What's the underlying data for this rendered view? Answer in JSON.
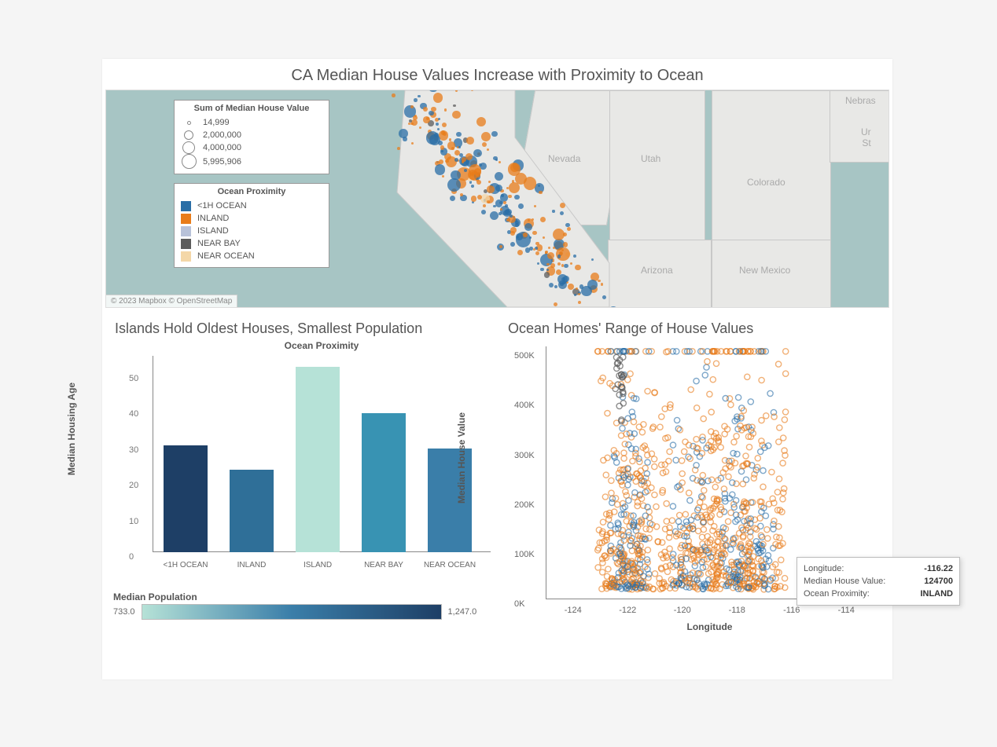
{
  "main_title": "CA Median House Values Increase with Proximity to Ocean",
  "map": {
    "attribution": "© 2023 Mapbox © OpenStreetMap",
    "state_labels": {
      "nv": "Nevada",
      "ut": "Utah",
      "co": "Colorado",
      "az": "Arizona",
      "nm": "New Mexico",
      "ne": "Nebras",
      "us": "Ur\nSt"
    },
    "size_legend": {
      "title": "Sum of Median House Value",
      "items": [
        {
          "label": "14,999",
          "size": 3
        },
        {
          "label": "2,000,000",
          "size": 10
        },
        {
          "label": "4,000,000",
          "size": 14
        },
        {
          "label": "5,995,906",
          "size": 17
        }
      ]
    },
    "color_legend": {
      "title": "Ocean Proximity",
      "items": [
        {
          "label": "<1H OCEAN",
          "color": "#2a6ea6"
        },
        {
          "label": "INLAND",
          "color": "#e87c1a"
        },
        {
          "label": "ISLAND",
          "color": "#b8c2d9"
        },
        {
          "label": "NEAR BAY",
          "color": "#5c5c5c"
        },
        {
          "label": "NEAR OCEAN",
          "color": "#f4d7a8"
        }
      ]
    }
  },
  "bar_panel": {
    "title": "Islands Hold Oldest Houses, Smallest Population",
    "header": "Ocean Proximity",
    "ylabel": "Median Housing Age",
    "population_legend": {
      "title": "Median Population",
      "min": "733.0",
      "max": "1,247.0"
    }
  },
  "scatter_panel": {
    "title": "Ocean Homes' Range of House Values",
    "ylabel": "Median House Value",
    "xlabel": "Longitude",
    "tooltip": {
      "rows": [
        {
          "k": "Longitude:",
          "v": "-116.22"
        },
        {
          "k": "Median House Value:",
          "v": "124700"
        },
        {
          "k": "Ocean Proximity:",
          "v": "INLAND"
        }
      ]
    }
  },
  "chart_data": [
    {
      "type": "map",
      "title": "CA Median House Values Increase with Proximity to Ocean",
      "color_by": "Ocean Proximity",
      "size_by": "Sum of Median House Value",
      "size_range": [
        14999,
        5995906
      ],
      "color_levels": [
        "<1H OCEAN",
        "INLAND",
        "ISLAND",
        "NEAR BAY",
        "NEAR OCEAN"
      ],
      "region": "California + neighboring states"
    },
    {
      "type": "bar",
      "title": "Islands Hold Oldest Houses, Smallest Population",
      "xlabel": "Ocean Proximity",
      "ylabel": "Median Housing Age",
      "ylim": [
        0,
        55
      ],
      "yticks": [
        0,
        10,
        20,
        30,
        40,
        50
      ],
      "color_scale": "Median Population",
      "color_range": [
        733.0,
        1247.0
      ],
      "categories": [
        "<1H OCEAN",
        "INLAND",
        "ISLAND",
        "NEAR BAY",
        "NEAR OCEAN"
      ],
      "values": [
        30,
        23,
        52,
        39,
        29
      ],
      "colors": [
        "#1e3f66",
        "#2f6f98",
        "#b6e2d7",
        "#3893b3",
        "#3a7ea9"
      ]
    },
    {
      "type": "scatter",
      "title": "Ocean Homes' Range of House Values",
      "xlabel": "Longitude",
      "ylabel": "Median House Value",
      "xlim": [
        -125,
        -113
      ],
      "xticks": [
        -124,
        -122,
        -120,
        -118,
        -116,
        -114
      ],
      "ylim": [
        0,
        510000
      ],
      "yticks": [
        0,
        100000,
        200000,
        300000,
        400000,
        500000
      ],
      "ytick_labels": [
        "0K",
        "100K",
        "200K",
        "300K",
        "400K",
        "500K"
      ],
      "color_by": "Ocean Proximity",
      "note": "Dense overlapping rings of <1H OCEAN (blue) and INLAND (orange) clustered around longitude bands near -122, -120 to -117; values span ~15K–500K with many capped at 500K."
    }
  ]
}
